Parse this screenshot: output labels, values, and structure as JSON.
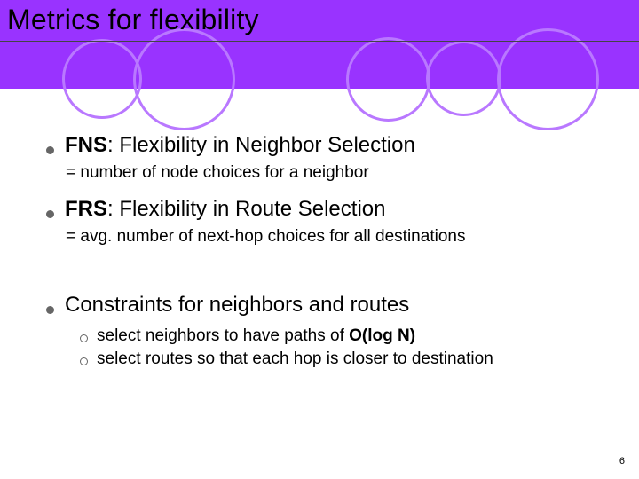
{
  "title": "Metrics for flexibility",
  "colors": {
    "accent": "#9933ff",
    "circle_stroke": "#b978ff",
    "bullet": "#666666"
  },
  "bullets": [
    {
      "term": "FNS",
      "expansion": ": Flexibility in Neighbor Selection",
      "sub": "= number of node choices for a neighbor"
    },
    {
      "term": "FRS",
      "expansion": ": Flexibility in Route Selection",
      "sub": "= avg. number of next-hop choices for all destinations"
    },
    {
      "text": "Constraints for neighbors and routes",
      "children": [
        {
          "pre": "select neighbors to have paths of ",
          "bold": "O(log N)",
          "post": ""
        },
        {
          "pre": "select routes so that each hop is closer to destination",
          "bold": "",
          "post": ""
        }
      ]
    }
  ],
  "page_number": "6"
}
